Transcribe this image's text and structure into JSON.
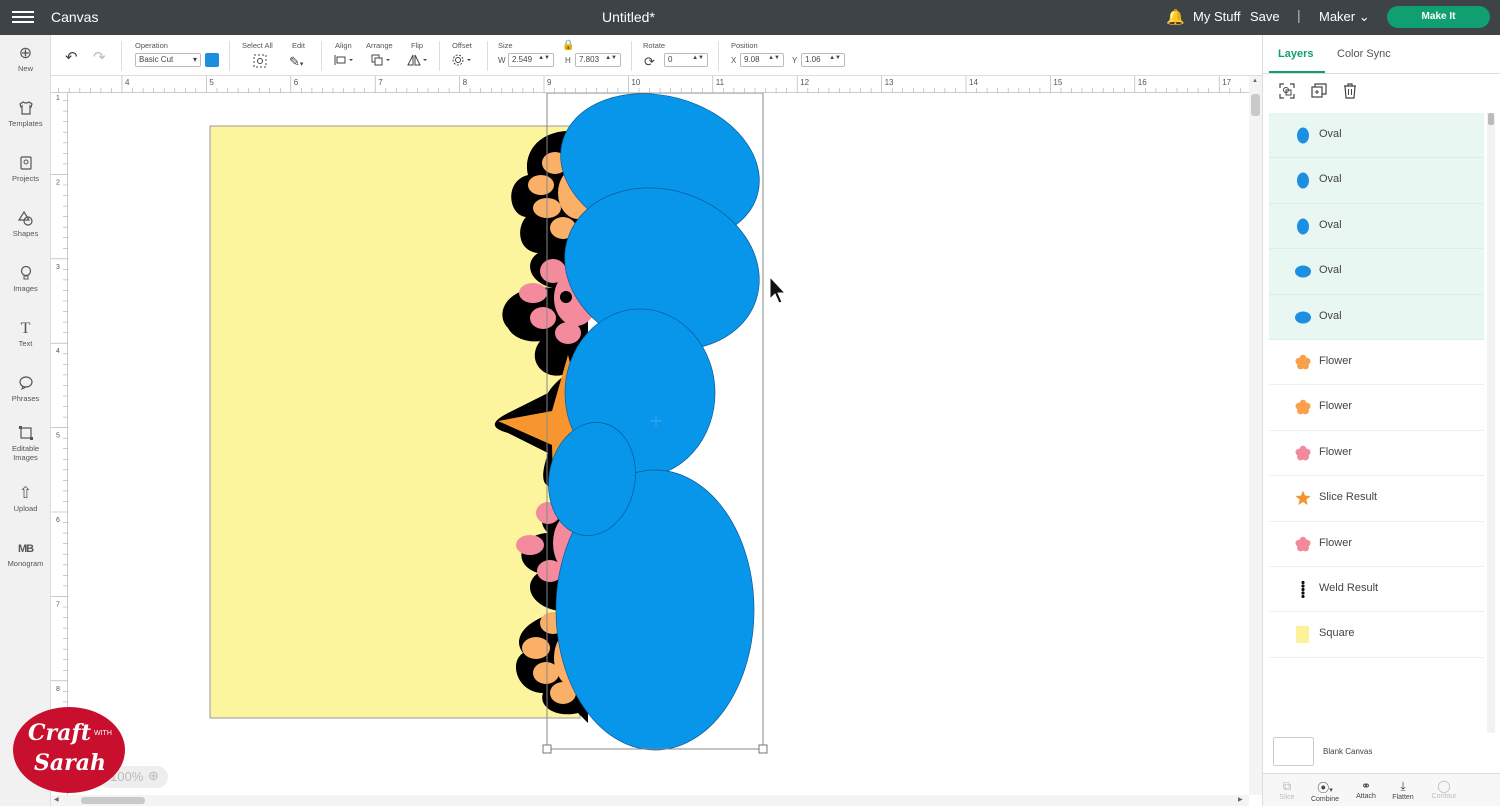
{
  "topbar": {
    "menu_icon": "hamburger-icon",
    "app_name": "Canvas",
    "doc_title": "Untitled*",
    "bell_icon": "bell-icon",
    "my_stuff": "My Stuff",
    "save": "Save",
    "separator": "|",
    "machine": "Maker",
    "make_it": "Make It",
    "accent": "#0f9f70"
  },
  "leftbar": {
    "items": [
      {
        "label": "New",
        "icon": "plus-circle-icon"
      },
      {
        "label": "Templates",
        "icon": "shirt-icon"
      },
      {
        "label": "Projects",
        "icon": "projects-icon"
      },
      {
        "label": "Shapes",
        "icon": "shapes-icon"
      },
      {
        "label": "Images",
        "icon": "lightbulb-icon"
      },
      {
        "label": "Text",
        "icon": "text-icon"
      },
      {
        "label": "Phrases",
        "icon": "speech-bubble-icon"
      },
      {
        "label": "Editable Images",
        "icon": "editable-image-icon"
      },
      {
        "label": "Upload",
        "icon": "upload-icon"
      },
      {
        "label": "Monogram",
        "icon": "monogram-icon"
      }
    ]
  },
  "toolbar": {
    "operation_label": "Operation",
    "operation_value": "Basic Cut",
    "operation_color": "#1a8fe0",
    "select_all_label": "Select All",
    "edit_label": "Edit",
    "align_label": "Align",
    "arrange_label": "Arrange",
    "flip_label": "Flip",
    "offset_label": "Offset",
    "size_label": "Size",
    "w_label": "W",
    "w_value": "2.549",
    "h_label": "H",
    "h_value": "7.803",
    "rotate_label": "Rotate",
    "rotate_value": "0",
    "position_label": "Position",
    "x_label": "X",
    "x_value": "9.08",
    "y_label": "Y",
    "y_value": "1.06"
  },
  "ruler": {
    "top_ticks": [
      "4",
      "5",
      "6",
      "7",
      "8",
      "9",
      "10",
      "11",
      "12",
      "13",
      "14",
      "15",
      "16",
      "17"
    ],
    "left_ticks": [
      "1",
      "2",
      "3",
      "4",
      "5",
      "6",
      "7",
      "8"
    ]
  },
  "panel": {
    "tab_layers": "Layers",
    "tab_color_sync": "Color Sync",
    "layers": [
      {
        "name": "Oval",
        "icon": "oval-icon",
        "color": "#1d8fe3",
        "selected": true
      },
      {
        "name": "Oval",
        "icon": "oval-icon",
        "color": "#1d8fe3",
        "selected": true
      },
      {
        "name": "Oval",
        "icon": "oval-icon",
        "color": "#1d8fe3",
        "selected": true
      },
      {
        "name": "Oval",
        "icon": "oval-icon",
        "color": "#1d8fe3",
        "selected": true
      },
      {
        "name": "Oval",
        "icon": "oval-icon",
        "color": "#1d8fe3",
        "selected": true
      },
      {
        "name": "Flower",
        "icon": "flower-icon",
        "color": "#f8a14a",
        "selected": false
      },
      {
        "name": "Flower",
        "icon": "flower-icon",
        "color": "#f8a14a",
        "selected": false
      },
      {
        "name": "Flower",
        "icon": "flower-icon",
        "color": "#f28a9c",
        "selected": false
      },
      {
        "name": "Slice Result",
        "icon": "star-icon",
        "color": "#f4942e",
        "selected": false
      },
      {
        "name": "Flower",
        "icon": "flower-icon",
        "color": "#f28a9c",
        "selected": false
      },
      {
        "name": "Weld Result",
        "icon": "weld-icon",
        "color": "#111111",
        "selected": false
      },
      {
        "name": "Square",
        "icon": "square-icon",
        "color": "#fdf19a",
        "selected": false
      }
    ],
    "blank_canvas": "Blank Canvas",
    "bottom_tools": [
      {
        "label": "Slice",
        "icon": "slice-icon",
        "disabled": true
      },
      {
        "label": "Combine",
        "icon": "combine-icon",
        "disabled": false
      },
      {
        "label": "Attach",
        "icon": "attach-icon",
        "disabled": false
      },
      {
        "label": "Flatten",
        "icon": "flatten-icon",
        "disabled": false
      },
      {
        "label": "Contour",
        "icon": "contour-icon",
        "disabled": true
      }
    ]
  },
  "canvas": {
    "square_color": "#fdf59e",
    "oval_color": "#0896ea",
    "zoom": "100%"
  },
  "logo": {
    "line1": "Craft",
    "with": "WITH",
    "line2": "Sarah",
    "color": "#c8102e"
  }
}
